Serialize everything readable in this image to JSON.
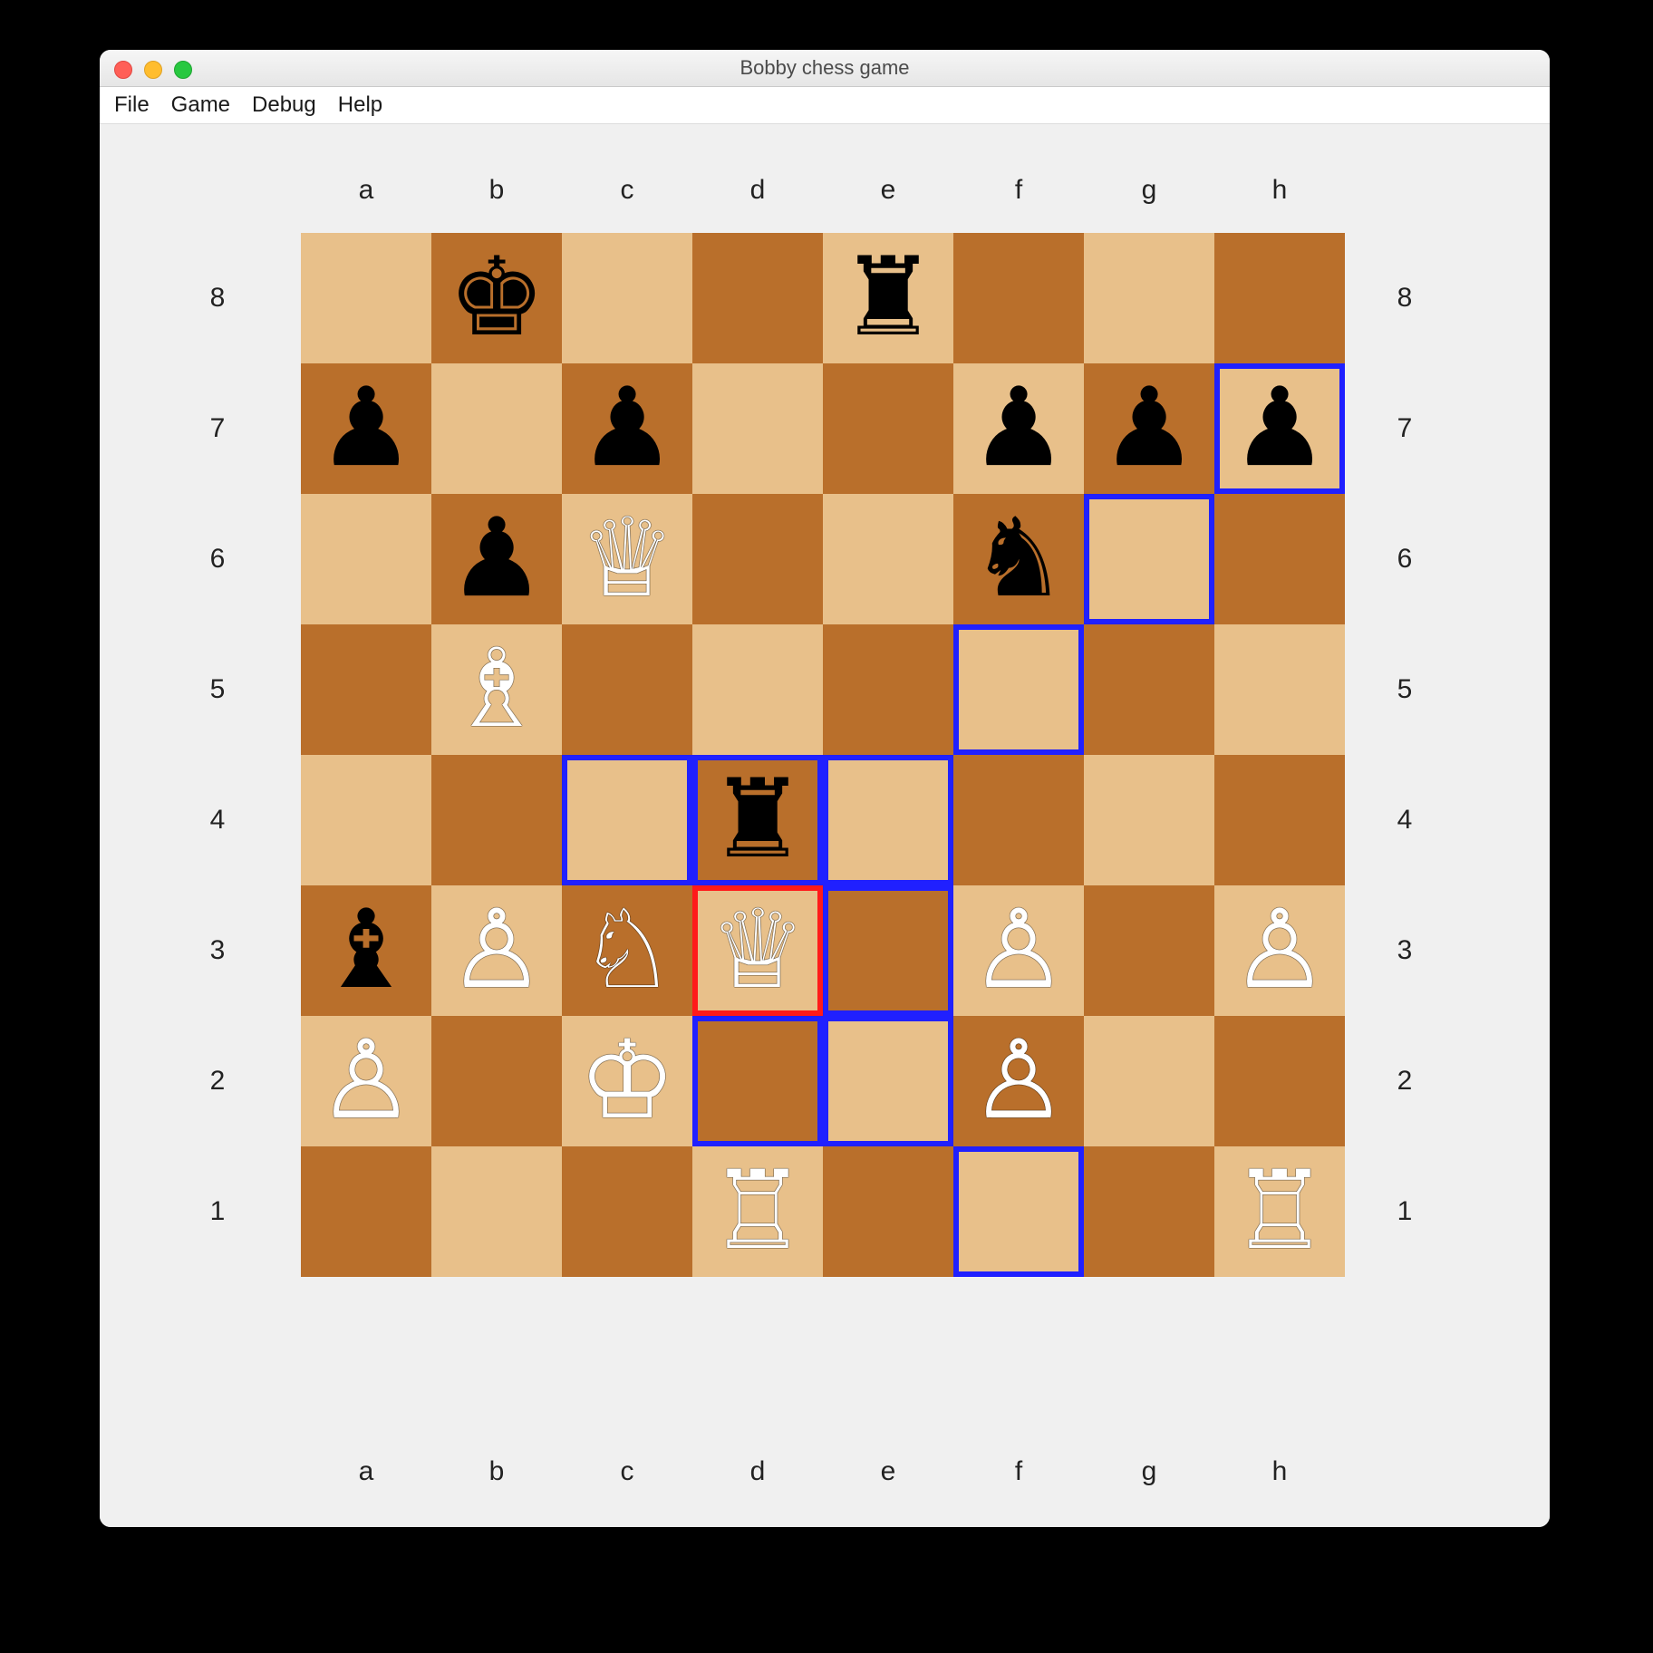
{
  "window": {
    "title": "Bobby chess game"
  },
  "menu": {
    "items": [
      "File",
      "Game",
      "Debug",
      "Help"
    ]
  },
  "board": {
    "files": [
      "a",
      "b",
      "c",
      "d",
      "e",
      "f",
      "g",
      "h"
    ],
    "ranks": [
      "8",
      "7",
      "6",
      "5",
      "4",
      "3",
      "2",
      "1"
    ],
    "light_color": "#e8c08a",
    "dark_color": "#b96f2b",
    "selected_square": "d3",
    "highlighted_squares": [
      "c4",
      "d4",
      "e4",
      "f5",
      "g6",
      "h7",
      "d2",
      "e2",
      "e3",
      "f1"
    ],
    "pieces": {
      "b8": {
        "type": "king",
        "color": "black",
        "glyph": "♚"
      },
      "e8": {
        "type": "rook",
        "color": "black",
        "glyph": "♜"
      },
      "a7": {
        "type": "pawn",
        "color": "black",
        "glyph": "♟"
      },
      "c7": {
        "type": "pawn",
        "color": "black",
        "glyph": "♟"
      },
      "f7": {
        "type": "pawn",
        "color": "black",
        "glyph": "♟"
      },
      "g7": {
        "type": "pawn",
        "color": "black",
        "glyph": "♟"
      },
      "h7": {
        "type": "pawn",
        "color": "black",
        "glyph": "♟"
      },
      "b6": {
        "type": "pawn",
        "color": "black",
        "glyph": "♟"
      },
      "c6": {
        "type": "queen",
        "color": "white",
        "glyph": "♕"
      },
      "f6": {
        "type": "knight",
        "color": "black",
        "glyph": "♞"
      },
      "b5": {
        "type": "bishop",
        "color": "white",
        "glyph": "♗"
      },
      "d4": {
        "type": "rook",
        "color": "black",
        "glyph": "♜"
      },
      "a3": {
        "type": "bishop",
        "color": "black",
        "glyph": "♝"
      },
      "b3": {
        "type": "pawn",
        "color": "white",
        "glyph": "♙"
      },
      "c3": {
        "type": "knight",
        "color": "white",
        "glyph": "♘"
      },
      "d3": {
        "type": "queen",
        "color": "white",
        "glyph": "♕"
      },
      "f3": {
        "type": "pawn",
        "color": "white",
        "glyph": "♙"
      },
      "h3": {
        "type": "pawn",
        "color": "white",
        "glyph": "♙"
      },
      "a2": {
        "type": "pawn",
        "color": "white",
        "glyph": "♙"
      },
      "c2": {
        "type": "king",
        "color": "white",
        "glyph": "♔"
      },
      "f2": {
        "type": "pawn",
        "color": "white",
        "glyph": "♙"
      },
      "d1": {
        "type": "rook",
        "color": "white",
        "glyph": "♖"
      },
      "h1": {
        "type": "rook",
        "color": "white",
        "glyph": "♖"
      }
    }
  }
}
